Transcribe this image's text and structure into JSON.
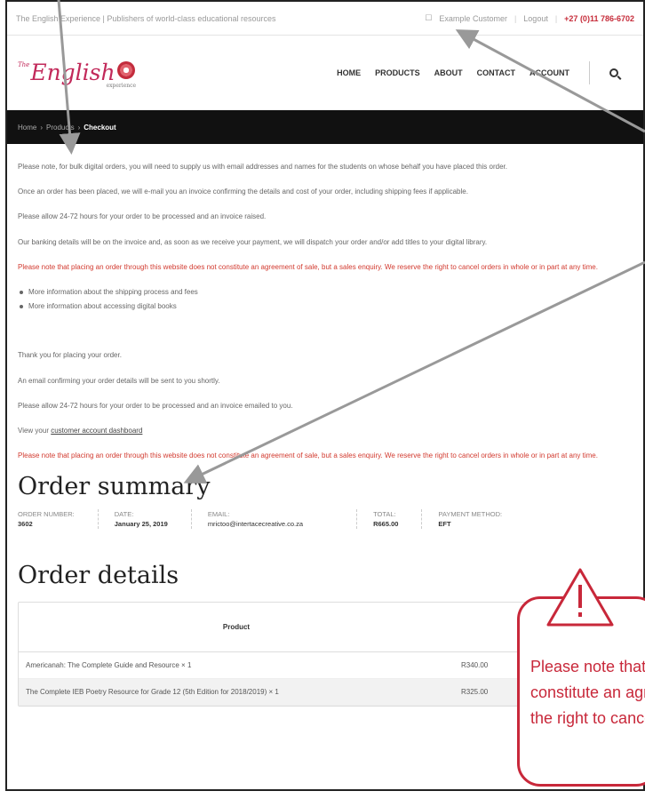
{
  "topbar": {
    "tagline": "The English Experience | Publishers of world-class educational resources",
    "customer": "Example Customer",
    "logout": "Logout",
    "phone": "+27 (0)11 786-6702"
  },
  "logo": {
    "the": "The",
    "word": "English",
    "sub": "experience"
  },
  "nav": {
    "items": [
      "HOME",
      "PRODUCTS",
      "ABOUT",
      "CONTACT",
      "ACCOUNT"
    ]
  },
  "breadcrumb": {
    "home": "Home",
    "products": "Products",
    "current": "Checkout"
  },
  "content": {
    "p1": "Please note, for bulk digital orders, you will need to supply us with email addresses and names for the students on whose behalf you have placed this order.",
    "p2": "Once an order has been placed, we will e-mail you an invoice confirming the details and cost of your order, including shipping fees if applicable.",
    "p3": "Please allow 24-72 hours for your order to be processed and an invoice raised.",
    "p4": "Our banking details will be on the invoice and, as soon as we receive your payment, we will dispatch your order and/or add titles to your digital library.",
    "p5": "Please note that placing an order through this website does not constitute an agreement of sale, but a sales enquiry. We reserve the right to cancel orders in whole or in part at any time.",
    "bullets": [
      "More information about the shipping process and fees",
      "More information about accessing digital books"
    ],
    "t1": "Thank you for placing your order.",
    "t2": "An email confirming your order details will be sent to you shortly.",
    "t3": "Please allow 24-72 hours for your order to be processed and an invoice emailed to you.",
    "t4_prefix": "View your",
    "t4_link": "customer account dashboard",
    "t5": "Please note that placing an order through this website does not constitute an agreement of sale, but a sales enquiry. We reserve the right to cancel orders in whole or in part at any time."
  },
  "summary": {
    "heading": "Order summary",
    "order_number_label": "ORDER NUMBER:",
    "order_number": "3602",
    "date_label": "DATE:",
    "date": "January 25, 2019",
    "email_label": "EMAIL:",
    "email": "mrictoo@intertacecreative.co.za",
    "total_label": "TOTAL:",
    "total": "R665.00",
    "payment_label": "PAYMENT METHOD:",
    "payment": "EFT"
  },
  "details": {
    "heading": "Order details",
    "col_product": "Product",
    "rows": [
      {
        "name": "Americanah: The Complete Guide and Resource × 1",
        "price": "R340.00"
      },
      {
        "name": "The Complete IEB Poetry Resource for Grade 12 (5th Edition for 2018/2019) × 1",
        "price": "R325.00"
      }
    ]
  },
  "callout": {
    "line1": "Please note that placing",
    "line2": "constitute an agreement",
    "line3": "the right to cancel orders"
  },
  "colors": {
    "accent": "#c8283a",
    "notice_text": "#d23a2f",
    "bar": "#111111"
  }
}
